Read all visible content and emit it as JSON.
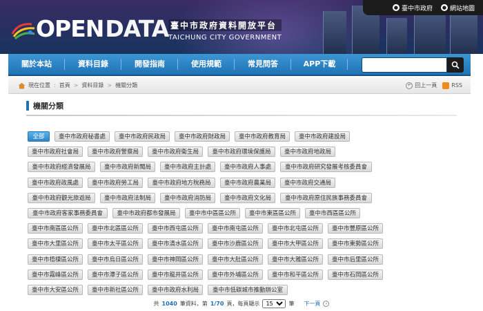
{
  "header": {
    "logo_prefix": "OPEN",
    "logo_suffix": "DATA",
    "title_cn": "臺中市政府資料開放平台",
    "title_en": "TAICHUNG CITY GOVERNMENT",
    "links": [
      "臺中市政府",
      "網站地圖"
    ]
  },
  "nav": {
    "items": [
      "關於本站",
      "資料目錄",
      "開發指南",
      "使用規範",
      "常見問答",
      "APP下載"
    ],
    "search_placeholder": ""
  },
  "breadcrumb": {
    "label": "現在位置",
    "items": [
      "首頁",
      "資料目錄",
      "機關分類"
    ],
    "back": "回上一頁",
    "rss": "RSS"
  },
  "section": {
    "title": "機關分類"
  },
  "tags": [
    [
      "全部",
      "臺中市政府秘書處",
      "臺中市政府民政局",
      "臺中市政府財政局",
      "臺中市政府教育局",
      "臺中市政府建設局"
    ],
    [
      "臺中市政府社會局",
      "臺中市政府警察局",
      "臺中市政府衛生局",
      "臺中市政府環境保護局",
      "臺中市政府地政局"
    ],
    [
      "臺中市政府經濟發展局",
      "臺中市政府新聞局",
      "臺中市政府主計處",
      "臺中市政府人事處",
      "臺中市政府研究發展考核委員會"
    ],
    [
      "臺中市政府政風處",
      "臺中市政府勞工局",
      "臺中市政府地方稅務局",
      "臺中市政府農業局",
      "臺中市政府交通局"
    ],
    [
      "臺中市政府觀光旅遊局",
      "臺中市政府法制局",
      "臺中市政府消防局",
      "臺中市政府文化局",
      "臺中市政府原住民族事務委員會"
    ],
    [
      "臺中市政府客家事務委員會",
      "臺中市政府都市發展局",
      "臺中市中區區公所",
      "臺中市東區區公所",
      "臺中市西區區公所"
    ],
    [
      "臺中市南區區公所",
      "臺中市北區區公所",
      "臺中市西屯區公所",
      "臺中市南屯區公所",
      "臺中市北屯區公所",
      "臺中市豐原區公所"
    ],
    [
      "臺中市大里區公所",
      "臺中市太平區公所",
      "臺中市清水區公所",
      "臺中市沙鹿區公所",
      "臺中市大甲區公所",
      "臺中市東勢區公所"
    ],
    [
      "臺中市梧棲區公所",
      "臺中市烏日區公所",
      "臺中市神岡區公所",
      "臺中市大肚區公所",
      "臺中市大雅區公所",
      "臺中市后里區公所"
    ],
    [
      "臺中市霧峰區公所",
      "臺中市潭子區公所",
      "臺中市龍井區公所",
      "臺中市外埔區公所",
      "臺中市和平區公所",
      "臺中市石岡區公所"
    ],
    [
      "臺中市大安區公所",
      "臺中市新社區公所",
      "臺中市政府水利局",
      "臺中市低碳城市推動辦公室"
    ]
  ],
  "pager": {
    "prefix": "共",
    "total": "1040",
    "total_suffix": "筆資料，第",
    "page": "1/70",
    "page_suffix": "頁，每頁顯示",
    "per_page": "15",
    "per_page_suffix": "筆",
    "next": "下一頁"
  },
  "colors": {
    "nav": "#2a84c9",
    "active_tag": "#3a92d6",
    "header_bg": "#2a2f62"
  }
}
